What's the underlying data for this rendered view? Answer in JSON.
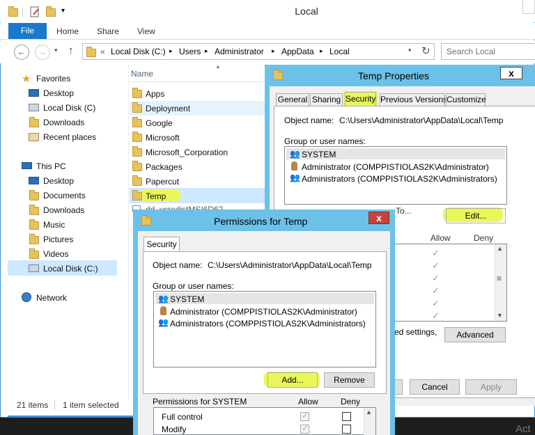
{
  "window": {
    "title": "Local"
  },
  "ribbon": {
    "file": "File",
    "tabs": [
      "Home",
      "Share",
      "View"
    ]
  },
  "address": {
    "prefix": "«",
    "crumbs": [
      "Local Disk (C:)",
      "Users",
      "Administrator",
      "AppData",
      "Local"
    ],
    "search_placeholder": "Search Local"
  },
  "nav": {
    "favorites": "Favorites",
    "favorite_items": [
      "Desktop",
      "Local Disk (C)",
      "Downloads",
      "Recent places"
    ],
    "this_pc": "This PC",
    "pc_items": [
      "Desktop",
      "Documents",
      "Downloads",
      "Music",
      "Pictures",
      "Videos",
      "Local Disk (C:)"
    ],
    "network": "Network"
  },
  "files": {
    "column_name": "Name",
    "items": [
      "Apps",
      "Deployment",
      "Google",
      "Microsoft",
      "Microsoft_Corporation",
      "Packages",
      "Papercut",
      "Temp"
    ],
    "partial_item": "dd_vcredistMSI6D62"
  },
  "status": {
    "count": "21 items",
    "selected": "1 item selected"
  },
  "props": {
    "title": "Temp Properties",
    "close": "x",
    "tabs": [
      "General",
      "Sharing",
      "Security",
      "Previous Versions",
      "Customize"
    ],
    "object_label": "Object name:",
    "object_value": "C:\\Users\\Administrator\\AppData\\Local\\Temp",
    "group_label": "Group or user names:",
    "users": [
      "SYSTEM",
      "Administrator (COMPPISTIOLAS2K\\Administrator)",
      "Administrators (COMPPISTIOLAS2K\\Administrators)"
    ],
    "partial_text": "To...",
    "edit": "Edit...",
    "allow": "Allow",
    "deny": "Deny",
    "special_text": "ed settings,",
    "advanced": "Advanced",
    "cancel": "Cancel",
    "apply": "Apply"
  },
  "perms": {
    "title": "Permissions for Temp",
    "close": "x",
    "tab": "Security",
    "object_label": "Object name:",
    "object_value": "C:\\Users\\Administrator\\AppData\\Local\\Temp",
    "group_label": "Group or user names:",
    "users": [
      "SYSTEM",
      "Administrator (COMPPISTIOLAS2K\\Administrator)",
      "Administrators (COMPPISTIOLAS2K\\Administrators)"
    ],
    "add": "Add...",
    "remove": "Remove",
    "perm_label": "Permissions for SYSTEM",
    "allow": "Allow",
    "deny": "Deny",
    "rows": [
      "Full control",
      "Modify"
    ]
  },
  "watermark": "Act",
  "colors": {
    "accent": "#1979ca",
    "highlight": "#e9f75a",
    "dialog_frame": "#6bc1e8"
  }
}
